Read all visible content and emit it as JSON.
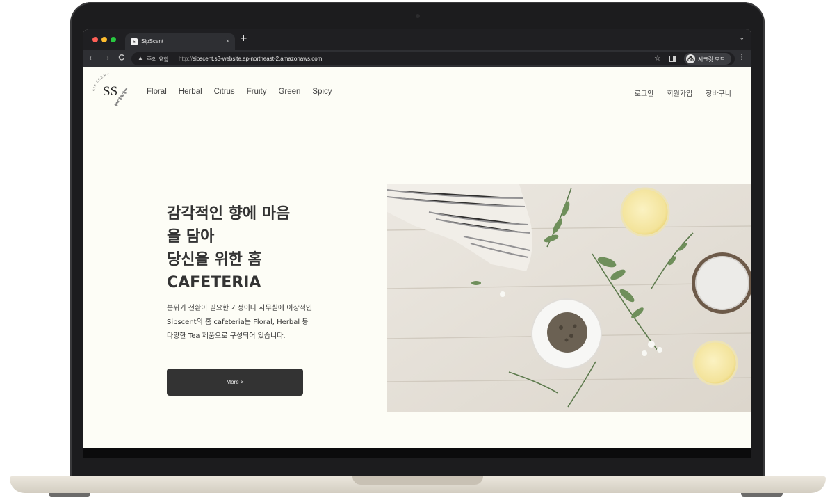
{
  "browser": {
    "tab_title": "SipScent",
    "tab_close": "×",
    "new_tab": "+",
    "tabs_menu": "⌄",
    "security_warning": "주의 요함",
    "url_scheme": "http://",
    "url_host": "sipscent.s3-website.ap-northeast-2.amazonaws.com",
    "incognito_label": "시크릿 모드",
    "back": "←",
    "forward": "→",
    "reload": "C",
    "star": "☆",
    "menu": "⋮"
  },
  "nav": {
    "categories": [
      "Floral",
      "Herbal",
      "Citrus",
      "Fruity",
      "Green",
      "Spicy"
    ],
    "account": [
      "로그인",
      "회원가입",
      "장바구니"
    ]
  },
  "logo": {
    "monogram": "SS",
    "arc_text": "SIP SCENT"
  },
  "hero": {
    "headline_lines": [
      "감각적인 향에 마음",
      "을 담아",
      "당신을 위한 홈",
      "CAFETERIA"
    ],
    "description": "분위기 전환이 필요한 가정이나 사무실에 이상적인 Sipscent의 홈 cafeteria는 Floral, Herbal 등 다양한 Tea 제품으로 구성되어 있습니다.",
    "button_label": "More >"
  },
  "colors": {
    "page_bg": "#fdfdf6",
    "button_bg": "#333333",
    "text": "#333333",
    "browser_dark": "#1f1f22"
  }
}
